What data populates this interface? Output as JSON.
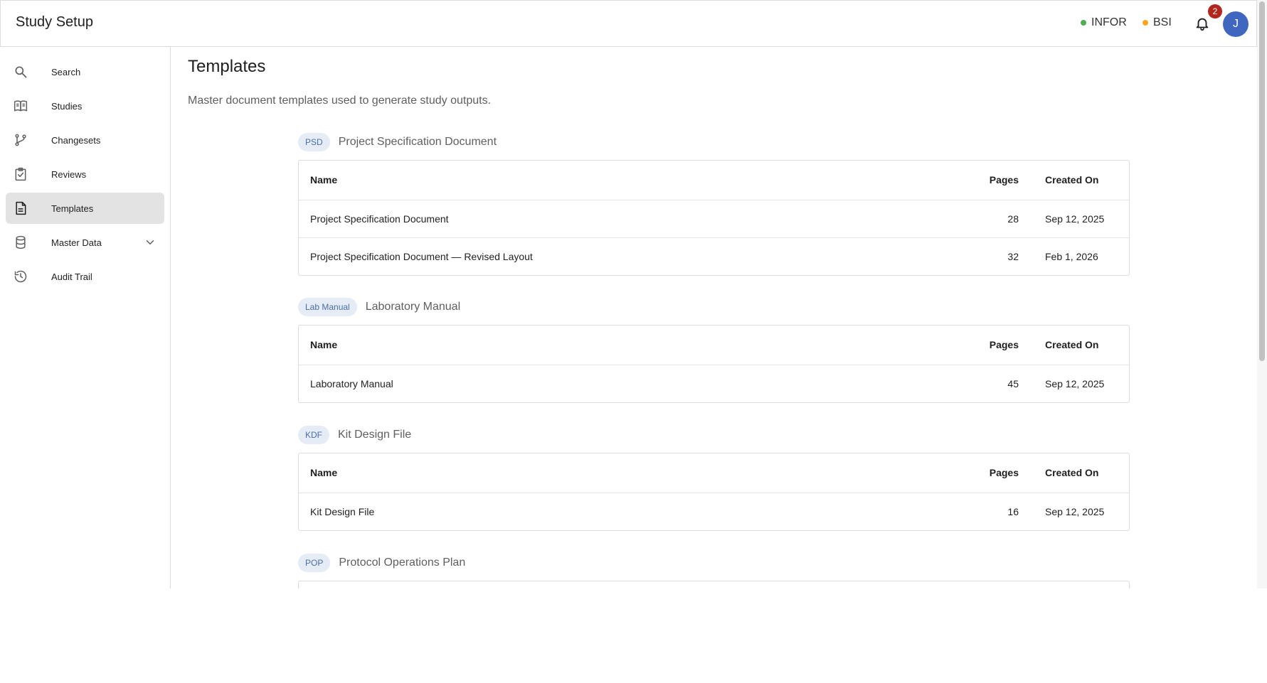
{
  "header": {
    "app_title": "Study Setup",
    "status": [
      {
        "label": "INFOR",
        "color": "#4caf50"
      },
      {
        "label": "BSI",
        "color": "#f5a623"
      }
    ],
    "notifications_count": "2",
    "avatar_initial": "J"
  },
  "sidebar": {
    "items": [
      {
        "label": "Search",
        "icon": "search-icon"
      },
      {
        "label": "Studies",
        "icon": "book-icon"
      },
      {
        "label": "Changesets",
        "icon": "branch-icon"
      },
      {
        "label": "Reviews",
        "icon": "clipboard-check-icon"
      },
      {
        "label": "Templates",
        "icon": "document-icon",
        "active": true
      },
      {
        "label": "Master Data",
        "icon": "database-icon",
        "expandable": true
      },
      {
        "label": "Audit Trail",
        "icon": "history-icon"
      }
    ]
  },
  "main": {
    "title": "Templates",
    "description": "Master document templates used to generate study outputs.",
    "columns": {
      "name": "Name",
      "pages": "Pages",
      "created_on": "Created On"
    },
    "groups": [
      {
        "code": "PSD",
        "title": "Project Specification Document",
        "rows": [
          {
            "name": "Project Specification Document",
            "pages": "28",
            "created_on": "Sep 12, 2025"
          },
          {
            "name": "Project Specification Document — Revised Layout",
            "pages": "32",
            "created_on": "Feb 1, 2026"
          }
        ]
      },
      {
        "code": "Lab Manual",
        "title": "Laboratory Manual",
        "rows": [
          {
            "name": "Laboratory Manual",
            "pages": "45",
            "created_on": "Sep 12, 2025"
          }
        ]
      },
      {
        "code": "KDF",
        "title": "Kit Design File",
        "rows": [
          {
            "name": "Kit Design File",
            "pages": "16",
            "created_on": "Sep 12, 2025"
          }
        ]
      },
      {
        "code": "POP",
        "title": "Protocol Operations Plan",
        "rows": []
      }
    ]
  },
  "colors": {
    "accent": "#3f67bf",
    "active_nav_bg": "#e3e3e3",
    "chip_bg": "#e6ecf6",
    "chip_text": "#4a6ea8",
    "badge": "#b3261e"
  }
}
